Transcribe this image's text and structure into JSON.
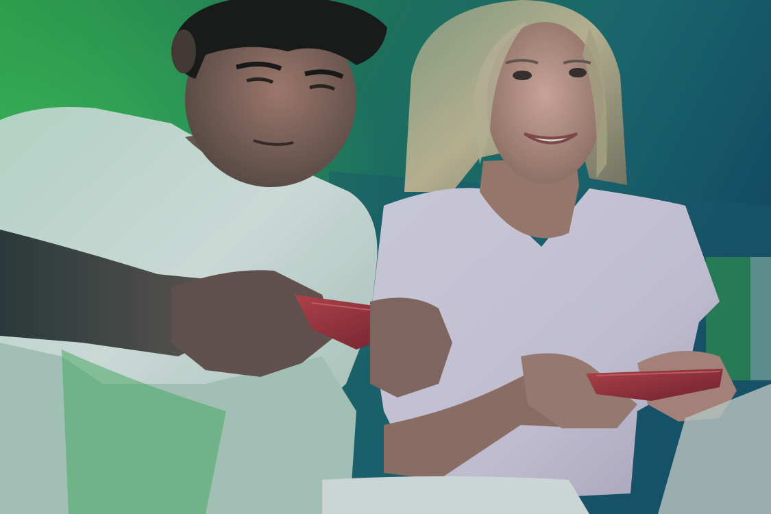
{
  "scene": {
    "subjects": [
      "man",
      "woman"
    ],
    "palette": {
      "background_green": "#2fa34a",
      "background_teal": "#1c6b72",
      "background_deep": "#155066",
      "shirt_man": "#d9e8e2",
      "shirt_woman": "#d8cfe3",
      "phone_red": "#a8323a",
      "skin": "#c99a8c",
      "hair_man": "#1b1714",
      "hair_woman": "#cbbf9a"
    },
    "icons": [
      "phone-icon",
      "phone-icon"
    ]
  }
}
